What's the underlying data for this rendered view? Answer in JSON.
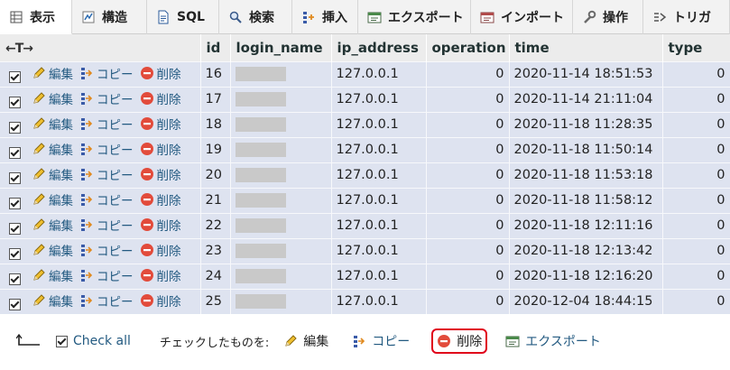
{
  "tabs": [
    {
      "label": "表示",
      "icon": "table-icon",
      "active": true,
      "width": 80
    },
    {
      "label": "構造",
      "icon": "structure-icon",
      "active": false,
      "width": 83
    },
    {
      "label": "SQL",
      "icon": "sql-icon",
      "active": false,
      "width": 80
    },
    {
      "label": "検索",
      "icon": "search-icon",
      "active": false,
      "width": 81
    },
    {
      "label": "挿入",
      "icon": "insert-icon",
      "active": false,
      "width": 73
    },
    {
      "label": "エクスポート",
      "icon": "export-icon",
      "active": false,
      "width": 125
    },
    {
      "label": "インポート",
      "icon": "import-icon",
      "active": false,
      "width": 113
    },
    {
      "label": "操作",
      "icon": "wrench-icon",
      "active": false,
      "width": 78
    },
    {
      "label": "トリガ",
      "icon": "trigger-icon",
      "active": false,
      "width": 96
    }
  ],
  "table": {
    "headers": [
      "id",
      "login_name",
      "ip_address",
      "operation",
      "time",
      "type"
    ],
    "row_actions": {
      "edit": "編集",
      "copy": "コピー",
      "delete": "削除"
    },
    "rows": [
      {
        "id": "16",
        "ip": "127.0.0.1",
        "operation": "0",
        "time": "2020-11-14 18:51:53",
        "type": "0"
      },
      {
        "id": "17",
        "ip": "127.0.0.1",
        "operation": "0",
        "time": "2020-11-14 21:11:04",
        "type": "0"
      },
      {
        "id": "18",
        "ip": "127.0.0.1",
        "operation": "0",
        "time": "2020-11-18 11:28:35",
        "type": "0"
      },
      {
        "id": "19",
        "ip": "127.0.0.1",
        "operation": "0",
        "time": "2020-11-18 11:50:14",
        "type": "0"
      },
      {
        "id": "20",
        "ip": "127.0.0.1",
        "operation": "0",
        "time": "2020-11-18 11:53:18",
        "type": "0"
      },
      {
        "id": "21",
        "ip": "127.0.0.1",
        "operation": "0",
        "time": "2020-11-18 11:58:12",
        "type": "0"
      },
      {
        "id": "22",
        "ip": "127.0.0.1",
        "operation": "0",
        "time": "2020-11-18 12:11:16",
        "type": "0"
      },
      {
        "id": "23",
        "ip": "127.0.0.1",
        "operation": "0",
        "time": "2020-11-18 12:13:42",
        "type": "0"
      },
      {
        "id": "24",
        "ip": "127.0.0.1",
        "operation": "0",
        "time": "2020-11-18 12:16:20",
        "type": "0"
      },
      {
        "id": "25",
        "ip": "127.0.0.1",
        "operation": "0",
        "time": "2020-12-04 18:44:15",
        "type": "0"
      }
    ]
  },
  "bottom": {
    "check_all": "Check all",
    "with_selected": "チェックしたものを:",
    "edit": "編集",
    "copy": "コピー",
    "delete": "削除",
    "export": "エクスポート"
  },
  "colors": {
    "highlight": "#e0001a",
    "row_bg": "#dee3f0",
    "link": "#235a81"
  }
}
